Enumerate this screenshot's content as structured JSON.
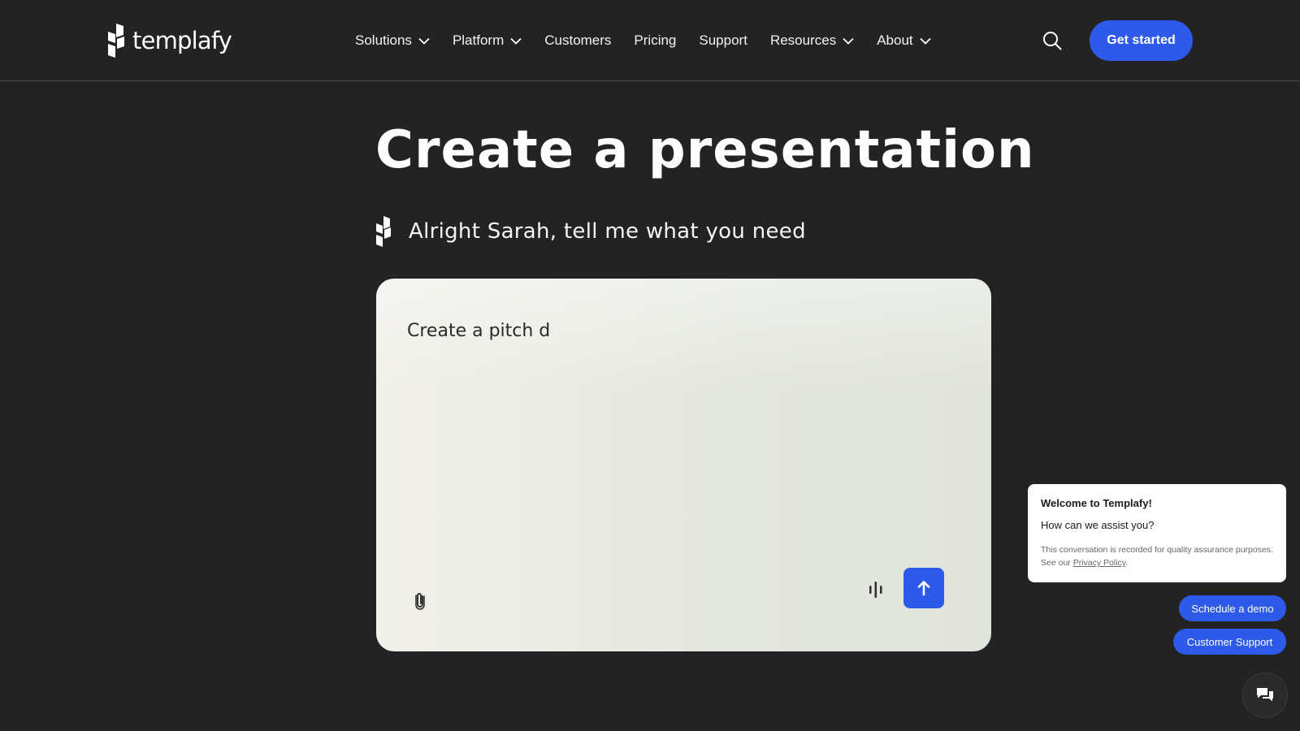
{
  "brand": {
    "name": "templafy"
  },
  "nav": {
    "items": [
      {
        "label": "Solutions",
        "has_dropdown": true
      },
      {
        "label": "Platform",
        "has_dropdown": true
      },
      {
        "label": "Customers",
        "has_dropdown": false
      },
      {
        "label": "Pricing",
        "has_dropdown": false
      },
      {
        "label": "Support",
        "has_dropdown": false
      },
      {
        "label": "Resources",
        "has_dropdown": true
      },
      {
        "label": "About",
        "has_dropdown": true
      }
    ],
    "search_icon": "search-icon",
    "cta_label": "Get started"
  },
  "hero": {
    "title": "Create a presentation",
    "assistant_message": "Alright Sarah, tell me what you need"
  },
  "prompt": {
    "value": "Create a pitch d",
    "attach_icon": "paperclip-icon",
    "voice_icon": "audio-wave-icon",
    "send_icon": "arrow-up-icon"
  },
  "chat": {
    "title": "Welcome to Templafy!",
    "subtitle": "How can we assist you?",
    "note_prefix": "This conversation is recorded for quality assurance purposes. See our ",
    "privacy_link": "Privacy Policy",
    "note_suffix": ".",
    "quick_replies": [
      "Schedule a demo",
      "Customer Support"
    ],
    "launcher_icon": "chat-bubbles-icon"
  },
  "colors": {
    "background": "#232323",
    "accent": "#2d5ae8",
    "card": "#e9ebe3"
  }
}
